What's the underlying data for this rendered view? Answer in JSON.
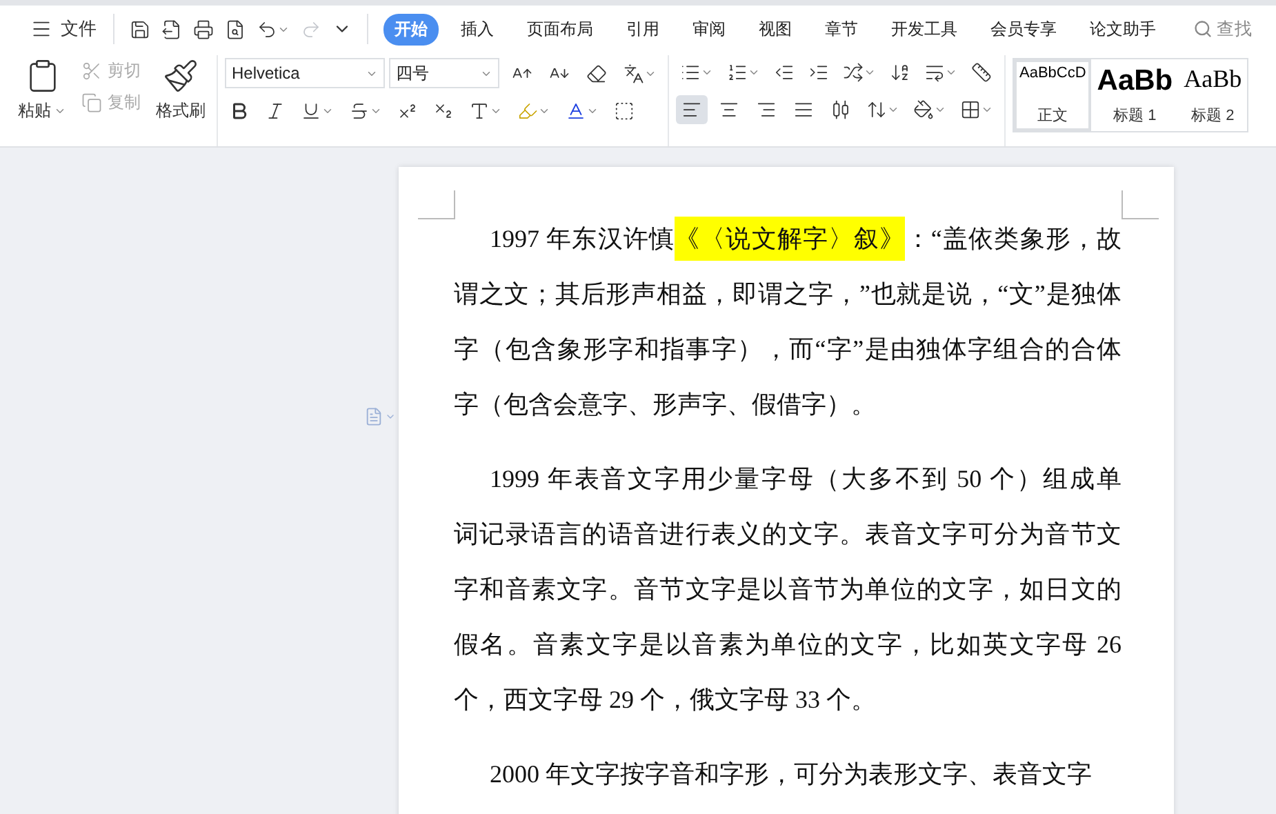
{
  "menu_bar": {
    "file_label": "文件",
    "tabs": [
      {
        "label": "开始",
        "selected": true
      },
      {
        "label": "插入",
        "selected": false
      },
      {
        "label": "页面布局",
        "selected": false
      },
      {
        "label": "引用",
        "selected": false
      },
      {
        "label": "审阅",
        "selected": false
      },
      {
        "label": "视图",
        "selected": false
      },
      {
        "label": "章节",
        "selected": false
      },
      {
        "label": "开发工具",
        "selected": false
      },
      {
        "label": "会员专享",
        "selected": false
      },
      {
        "label": "论文助手",
        "selected": false
      }
    ],
    "search_label": "查找",
    "undo_disabled": false,
    "redo_disabled": true
  },
  "clipboard": {
    "paste": "粘贴",
    "cut": {
      "label": "剪切",
      "disabled": true
    },
    "copy": {
      "label": "复制",
      "disabled": true
    },
    "format_painter": "格式刷"
  },
  "font": {
    "family": "Helvetica",
    "size": "四号"
  },
  "alignment": [
    {
      "kind": "left",
      "selected": true
    },
    {
      "kind": "center",
      "selected": false
    },
    {
      "kind": "right",
      "selected": false
    },
    {
      "kind": "justify",
      "selected": false
    },
    {
      "kind": "distribute",
      "selected": false
    }
  ],
  "styles": [
    {
      "kind": "body",
      "preview": "AaBbCcD",
      "label": "正文",
      "selected": true
    },
    {
      "kind": "heading1",
      "preview": "AaBb",
      "label": "标题 1",
      "selected": false
    },
    {
      "kind": "heading2",
      "preview": "AaBb",
      "label": "标题 2",
      "selected": false
    }
  ],
  "document": {
    "paragraphs": [
      {
        "lines": [
          [
            {
              "text": "1997 年东汉许慎",
              "highlighted": false
            },
            {
              "text": "《〈说文解字〉叙》",
              "highlighted": true
            },
            {
              "text": "：“盖依类象形，故",
              "highlighted": false
            }
          ],
          [
            {
              "text": "谓之文；其后形声相益，即谓之字，”也就是说，“文”是独体",
              "highlighted": false
            }
          ],
          [
            {
              "text": "字（包含象形字和指事字），而“字”是由独体字组合的合体",
              "highlighted": false
            }
          ],
          [
            {
              "text": "字（包含会意字、形声字、假借字）。",
              "highlighted": false
            }
          ]
        ]
      },
      {
        "lines": [
          [
            {
              "text": "1999 年表音文字用少量字母（大多不到 50 个）组成单",
              "highlighted": false
            }
          ],
          [
            {
              "text": "词记录语言的语音进行表义的文字。表音文字可分为音节文",
              "highlighted": false
            }
          ],
          [
            {
              "text": "字和音素文字。音节文字是以音节为单位的文字，如日文的",
              "highlighted": false
            }
          ],
          [
            {
              "text": "假名。音素文字是以音素为单位的文字，比如英文字母 26",
              "highlighted": false
            }
          ],
          [
            {
              "text": "个，西文字母 29 个，俄文字母 33 个。",
              "highlighted": false
            }
          ]
        ]
      },
      {
        "lines": [
          [
            {
              "text": "2000 年文字按字音和字形，可分为表形文字、表音文字",
              "highlighted": false
            }
          ]
        ]
      }
    ]
  }
}
